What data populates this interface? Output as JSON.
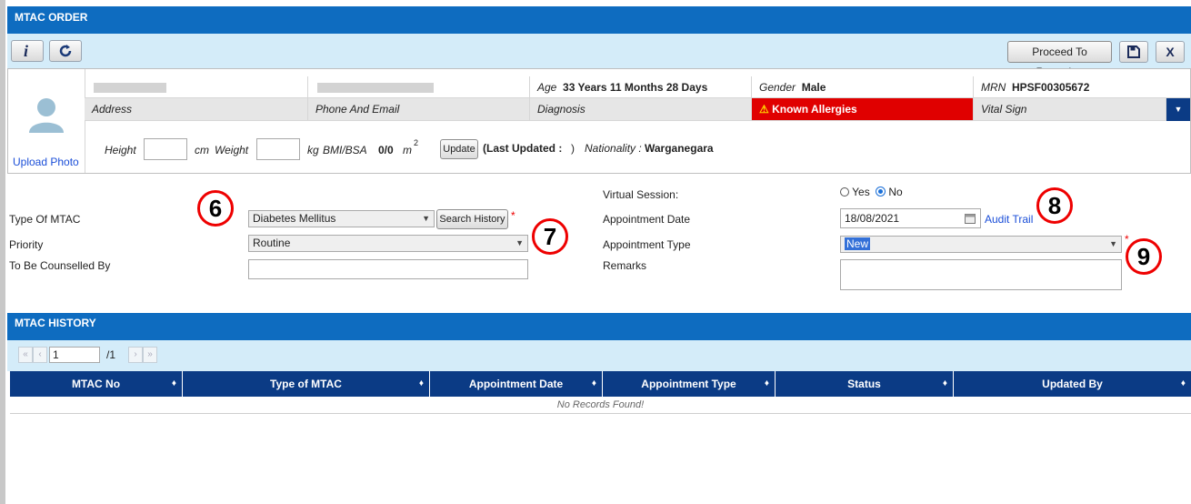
{
  "window": {
    "title": "MTAC ORDER"
  },
  "toolbar": {
    "proceed_label": "Proceed To Reporting",
    "info_icon": "info-icon",
    "refresh_icon": "refresh-icon",
    "save_icon": "save-icon",
    "close_label": "X"
  },
  "patient": {
    "age_label": "Age",
    "age_value": "33 Years 11 Months 28 Days",
    "gender_label": "Gender",
    "gender_value": "Male",
    "mrn_label": "MRN",
    "mrn_value": "HPSF00305672",
    "address_label": "Address",
    "phone_label": "Phone And Email",
    "diagnosis_label": "Diagnosis",
    "allergies_label": "Known Allergies",
    "vital_label": "Vital Sign",
    "upload_label": "Upload Photo",
    "height_label": "Height",
    "height_unit": "cm",
    "weight_label": "Weight",
    "weight_unit": "kg",
    "bmi_label": "BMI/BSA",
    "bmi_value": "0/0",
    "bmi_unit": "m",
    "bmi_sup": "2",
    "update_label": "Update",
    "last_updated_label": "(Last Updated :",
    "last_updated_close": ")",
    "nationality_label": "Nationality :",
    "nationality_value": "Warganegara"
  },
  "form": {
    "type_label": "Type Of MTAC",
    "type_value": "Diabetes Mellitus",
    "search_history_label": "Search History",
    "required_mark": "*",
    "priority_label": "Priority",
    "priority_value": "Routine",
    "counselled_label": "To Be Counselled By",
    "counselled_value": "",
    "virtual_label": "Virtual Session:",
    "virtual_yes": "Yes",
    "virtual_no": "No",
    "appt_date_label": "Appointment Date",
    "appt_date_value": "18/08/2021",
    "audit_trail_label": "Audit Trail",
    "appt_type_label": "Appointment Type",
    "appt_type_value": "New",
    "remarks_label": "Remarks",
    "remarks_value": ""
  },
  "annotations": [
    "6",
    "7",
    "8",
    "9"
  ],
  "history": {
    "title": "MTAC HISTORY",
    "page_value": "1",
    "page_total": "/1",
    "columns": [
      "MTAC No",
      "Type of MTAC",
      "Appointment Date",
      "Appointment Type",
      "Status",
      "Updated By"
    ],
    "empty_text": "No Records Found!"
  },
  "colors": {
    "header": "#0e6cc0",
    "table_header": "#0b3b85",
    "allergy": "#e00000",
    "toolbar_bg": "#d4ecf9"
  }
}
